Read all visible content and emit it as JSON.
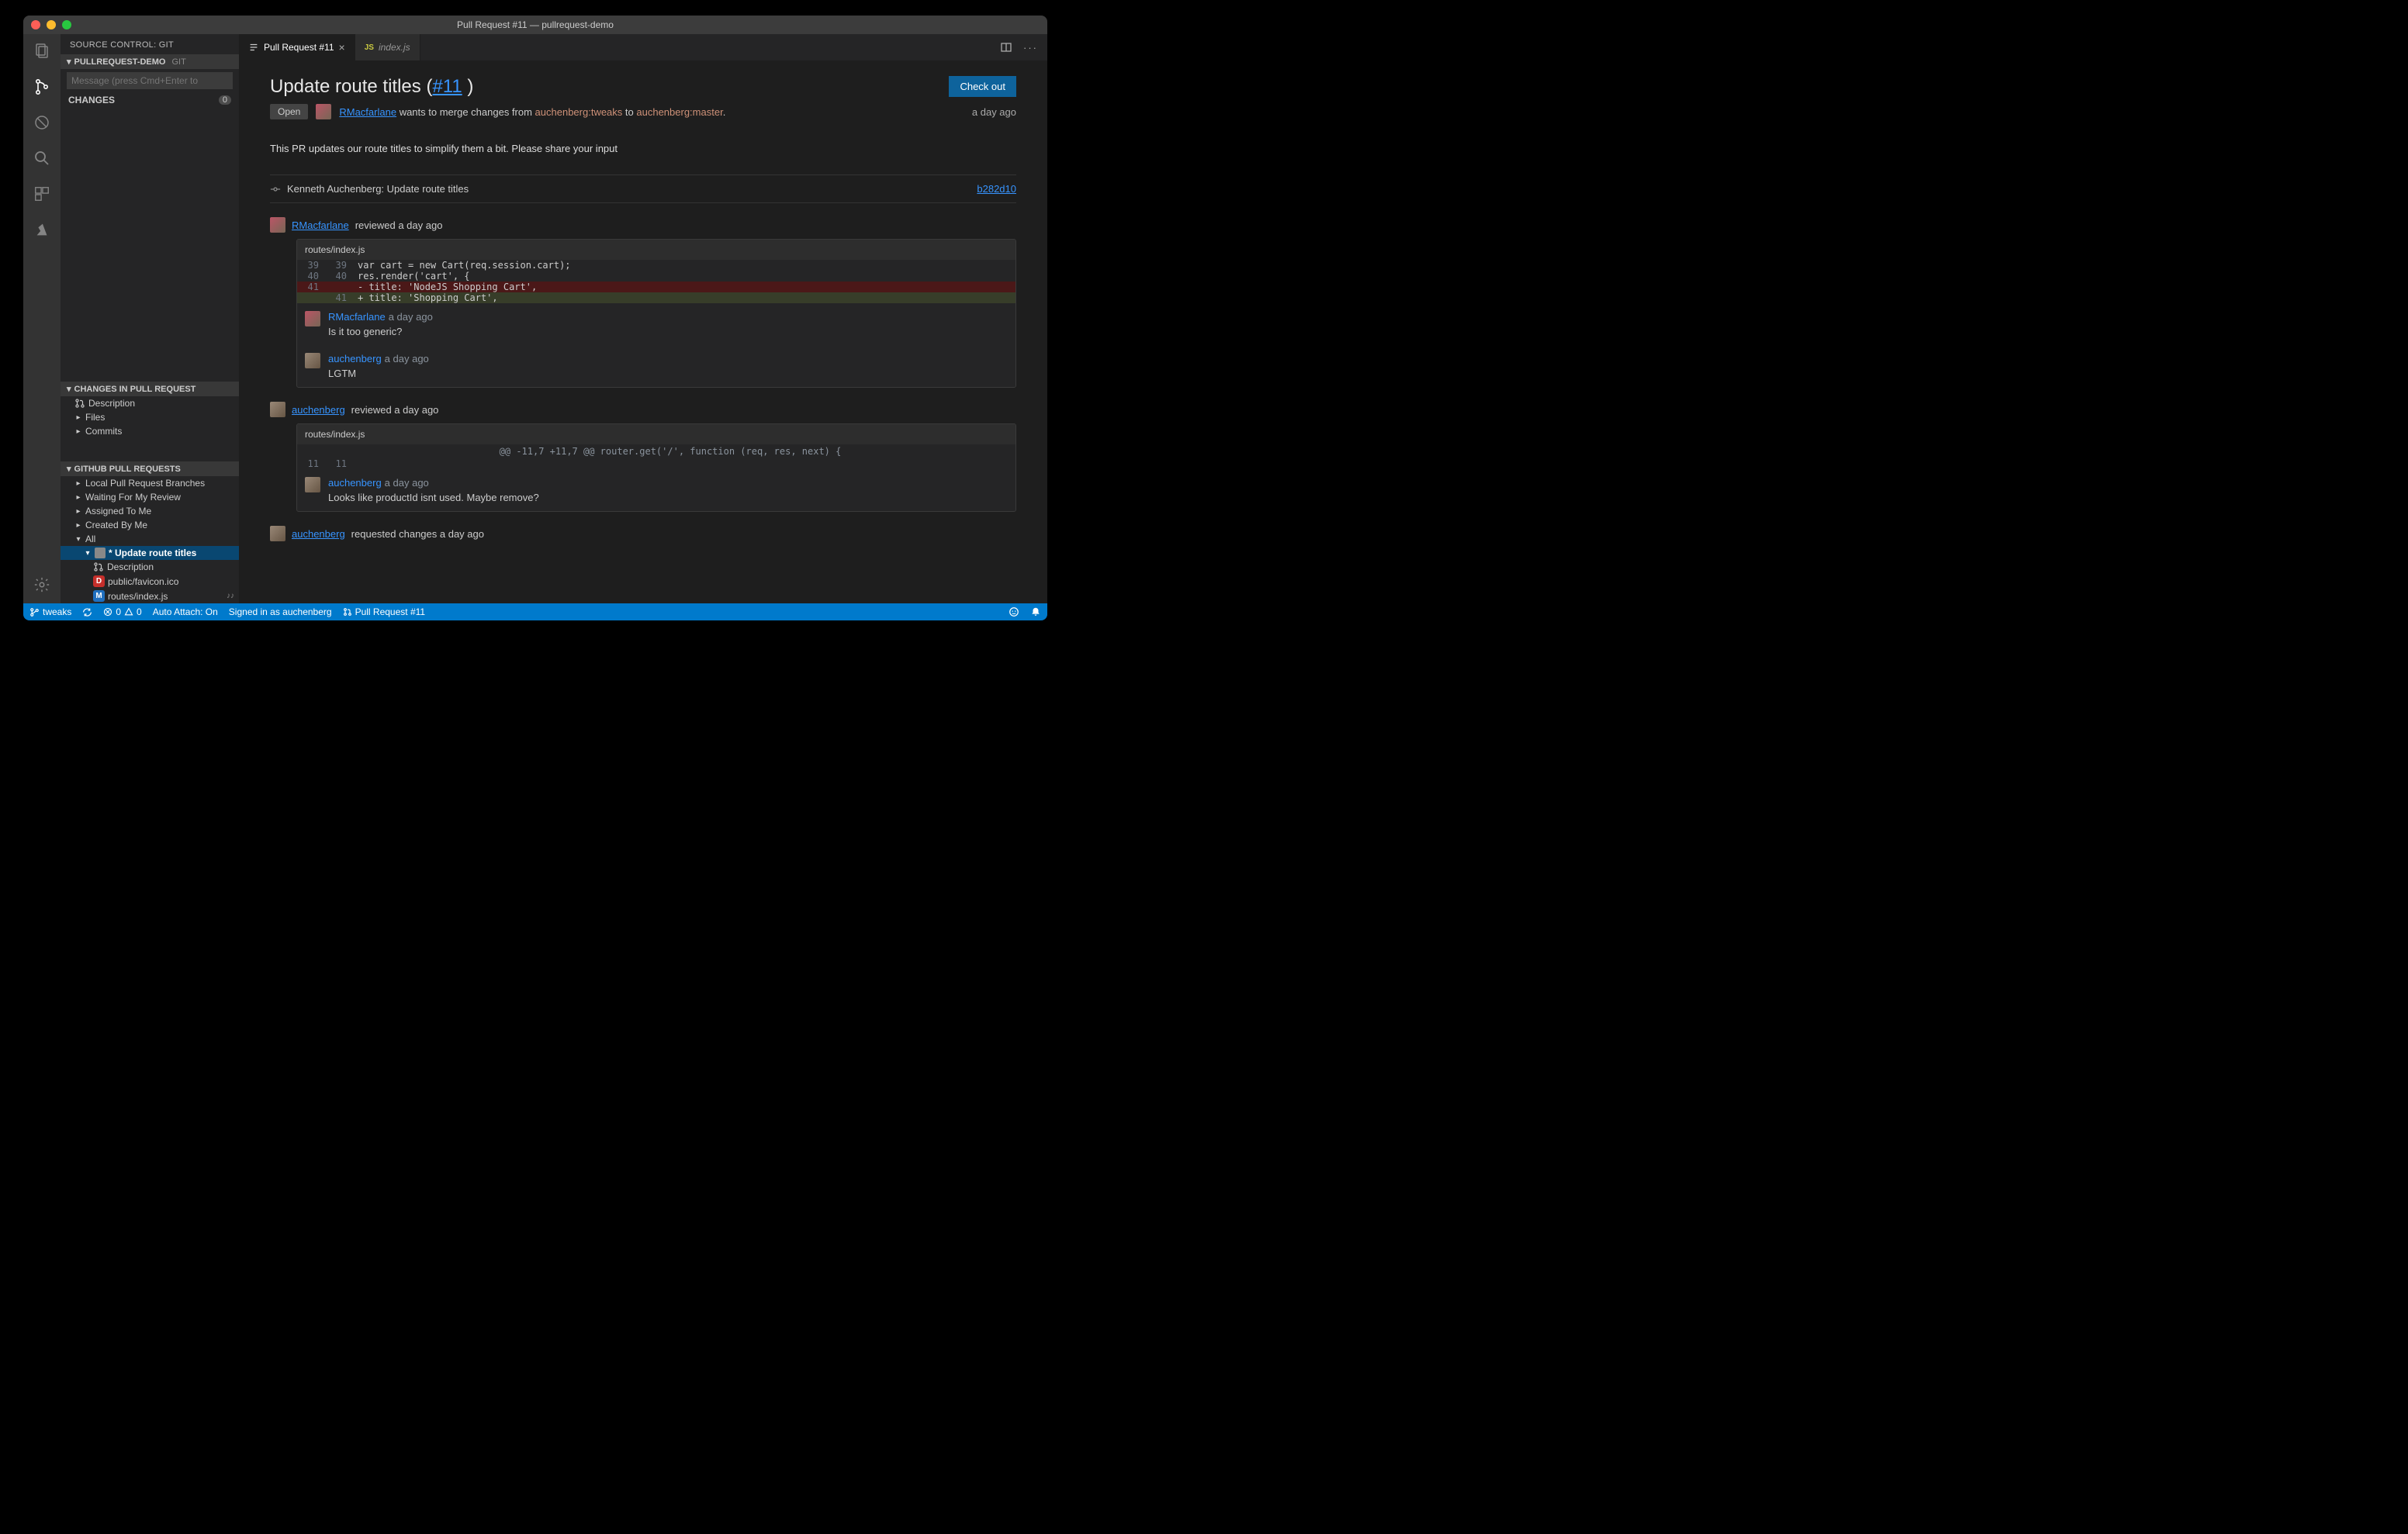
{
  "window_title": "Pull Request #11 — pullrequest-demo",
  "sidebar": {
    "title": "SOURCE CONTROL: GIT",
    "repo_section": {
      "label": "PULLREQUEST-DEMO",
      "sub": "GIT"
    },
    "commit_placeholder": "Message (press Cmd+Enter to",
    "changes_label": "CHANGES",
    "changes_count": "0",
    "changes_in_pr_label": "CHANGES IN PULL REQUEST",
    "changes_in_pr_items": {
      "description": "Description",
      "files": "Files",
      "commits": "Commits"
    },
    "ghpr_label": "GITHUB PULL REQUESTS",
    "ghpr_items": {
      "local": "Local Pull Request Branches",
      "waiting": "Waiting For My Review",
      "assigned": "Assigned To Me",
      "created": "Created By Me",
      "all": "All"
    },
    "pr_item_label": "* Update route titles",
    "pr_children": {
      "description": "Description",
      "file1": "public/favicon.ico",
      "file2": "routes/index.js"
    }
  },
  "tabs": {
    "tab1": "Pull Request #11",
    "tab2": "index.js"
  },
  "pr": {
    "title_prefix": "Update route titles (",
    "title_link": "#11",
    "title_suffix": " )",
    "checkout": "Check out",
    "status": "Open",
    "author": "RMacfarlane",
    "merge_text_1": " wants to merge changes from ",
    "source_branch": "auchenberg:tweaks",
    "merge_text_2": " to ",
    "target_branch": "auchenberg:master",
    "timestamp": "a day ago",
    "description": "This PR updates our route titles to simplify them a bit. Please share your input",
    "commit": {
      "author": "Kenneth Auchenberg: Update route titles",
      "sha": "b282d10"
    },
    "review1": {
      "user": "RMacfarlane",
      "summary": "reviewed a day ago",
      "file": "routes/index.js",
      "line39_old": "39",
      "line39_new": "39",
      "code39": "var cart = new Cart(req.session.cart);",
      "line40_old": "40",
      "line40_new": "40",
      "code40": "res.render('cart', {",
      "line41_old": "41",
      "code_del": "- title: 'NodeJS Shopping Cart',",
      "line41_new": "41",
      "code_add": "+ title: 'Shopping Cart',",
      "c1_user": "RMacfarlane",
      "c1_ts": "a day ago",
      "c1_text": "Is it too generic?",
      "c2_user": "auchenberg",
      "c2_ts": "a day ago",
      "c2_text": "LGTM"
    },
    "review2": {
      "user": "auchenberg",
      "summary": "reviewed a day ago",
      "file": "routes/index.js",
      "hunk": "@@ -11,7 +11,7 @@ router.get('/', function (req, res, next) {",
      "line_old": "11",
      "line_new": "11",
      "c1_user": "auchenberg",
      "c1_ts": "a day ago",
      "c1_text": "Looks like productId isnt used. Maybe remove?"
    },
    "review3": {
      "user": "auchenberg",
      "summary": "requested changes a day ago"
    }
  },
  "statusbar": {
    "branch": "tweaks",
    "errors": "0",
    "warnings": "0",
    "auto_attach": "Auto Attach: On",
    "signed_in": "Signed in as auchenberg",
    "pr": "Pull Request #11"
  }
}
